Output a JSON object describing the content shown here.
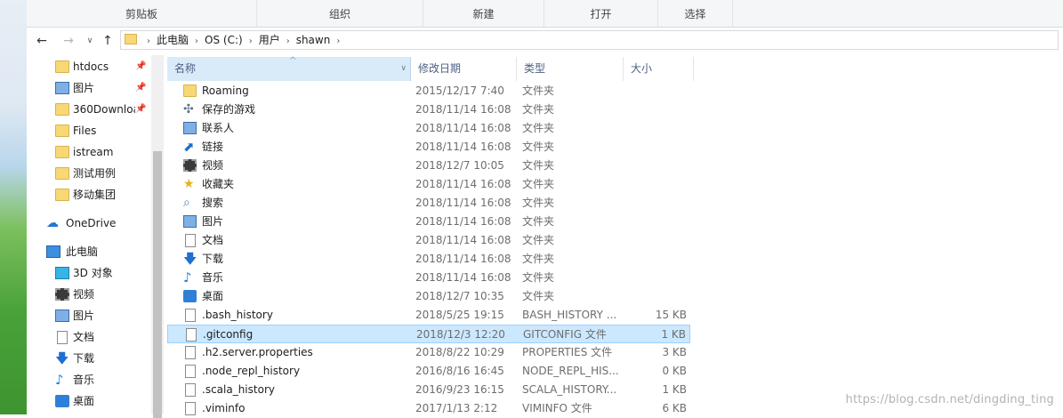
{
  "ribbon": {
    "groups": [
      "剪贴板",
      "组织",
      "新建",
      "打开",
      "选择"
    ]
  },
  "address": {
    "path": [
      "此电脑",
      "OS (C:)",
      "用户",
      "shawn"
    ]
  },
  "nav": {
    "quick_access": [
      {
        "label": "htdocs",
        "icon": "folder-icon",
        "pinned": true
      },
      {
        "label": "图片",
        "icon": "pictures-icon",
        "pinned": true
      },
      {
        "label": "360Downloa",
        "icon": "folder-icon",
        "pinned": true
      },
      {
        "label": "Files",
        "icon": "folder-icon",
        "pinned": false
      },
      {
        "label": "istream",
        "icon": "folder-icon",
        "pinned": false
      },
      {
        "label": "测试用例",
        "icon": "folder-icon",
        "pinned": false
      },
      {
        "label": "移动集团",
        "icon": "folder-icon",
        "pinned": false
      }
    ],
    "onedrive": "OneDrive",
    "this_pc": "此电脑",
    "this_pc_items": [
      {
        "label": "3D 对象",
        "icon": "3d-objects-icon"
      },
      {
        "label": "视频",
        "icon": "videos-icon"
      },
      {
        "label": "图片",
        "icon": "pictures-icon"
      },
      {
        "label": "文档",
        "icon": "documents-icon"
      },
      {
        "label": "下载",
        "icon": "downloads-icon"
      },
      {
        "label": "音乐",
        "icon": "music-icon"
      },
      {
        "label": "桌面",
        "icon": "desktop-icon"
      }
    ]
  },
  "columns": {
    "name": "名称",
    "date": "修改日期",
    "type": "类型",
    "size": "大小"
  },
  "files": [
    {
      "name": "Roaming",
      "date": "2015/12/17 7:40",
      "type": "文件夹",
      "size": "",
      "icon": "folder-icon"
    },
    {
      "name": "保存的游戏",
      "date": "2018/11/14 16:08",
      "type": "文件夹",
      "size": "",
      "icon": "saved-games-icon"
    },
    {
      "name": "联系人",
      "date": "2018/11/14 16:08",
      "type": "文件夹",
      "size": "",
      "icon": "contacts-icon"
    },
    {
      "name": "链接",
      "date": "2018/11/14 16:08",
      "type": "文件夹",
      "size": "",
      "icon": "links-icon"
    },
    {
      "name": "视频",
      "date": "2018/12/7 10:05",
      "type": "文件夹",
      "size": "",
      "icon": "videos-icon"
    },
    {
      "name": "收藏夹",
      "date": "2018/11/14 16:08",
      "type": "文件夹",
      "size": "",
      "icon": "favorites-icon"
    },
    {
      "name": "搜索",
      "date": "2018/11/14 16:08",
      "type": "文件夹",
      "size": "",
      "icon": "searches-icon"
    },
    {
      "name": "图片",
      "date": "2018/11/14 16:08",
      "type": "文件夹",
      "size": "",
      "icon": "pictures-icon"
    },
    {
      "name": "文档",
      "date": "2018/11/14 16:08",
      "type": "文件夹",
      "size": "",
      "icon": "documents-icon"
    },
    {
      "name": "下载",
      "date": "2018/11/14 16:08",
      "type": "文件夹",
      "size": "",
      "icon": "downloads-icon"
    },
    {
      "name": "音乐",
      "date": "2018/11/14 16:08",
      "type": "文件夹",
      "size": "",
      "icon": "music-icon"
    },
    {
      "name": "桌面",
      "date": "2018/12/7 10:35",
      "type": "文件夹",
      "size": "",
      "icon": "desktop-icon"
    },
    {
      "name": ".bash_history",
      "date": "2018/5/25 19:15",
      "type": "BASH_HISTORY ...",
      "size": "15 KB",
      "icon": "file-icon"
    },
    {
      "name": ".gitconfig",
      "date": "2018/12/3 12:20",
      "type": "GITCONFIG 文件",
      "size": "1 KB",
      "icon": "file-icon",
      "selected": true
    },
    {
      "name": ".h2.server.properties",
      "date": "2018/8/22 10:29",
      "type": "PROPERTIES 文件",
      "size": "3 KB",
      "icon": "file-icon"
    },
    {
      "name": ".node_repl_history",
      "date": "2016/8/16 16:45",
      "type": "NODE_REPL_HIS...",
      "size": "0 KB",
      "icon": "file-icon"
    },
    {
      "name": ".scala_history",
      "date": "2016/9/23 16:15",
      "type": "SCALA_HISTORY...",
      "size": "1 KB",
      "icon": "file-icon"
    },
    {
      "name": ".viminfo",
      "date": "2017/1/13 2:12",
      "type": "VIMINFO 文件",
      "size": "6 KB",
      "icon": "file-icon"
    }
  ],
  "watermark": "https://blog.csdn.net/dingding_ting",
  "colors": {
    "selected_bg": "#cce8ff",
    "selected_border": "#99d1ff",
    "header_bg": "#d9ebf9",
    "folder": "#f8d775"
  }
}
